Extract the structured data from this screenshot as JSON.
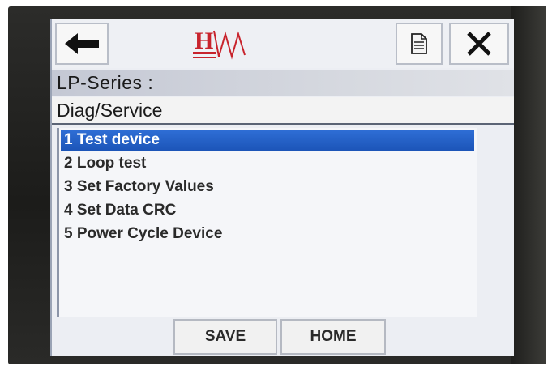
{
  "header": {
    "back_icon": "arrow-left-icon",
    "logo_text": "H",
    "doc_icon": "document-icon",
    "close_icon": "close-icon",
    "colors": {
      "logo_red": "#c8232c",
      "selection_blue": "#1f5fc4"
    }
  },
  "device": {
    "series_label": "LP-Series    :"
  },
  "menu": {
    "title": "Diag/Service"
  },
  "list": {
    "items": [
      {
        "label": "1 Test device",
        "selected": true
      },
      {
        "label": "2 Loop test",
        "selected": false
      },
      {
        "label": "3 Set Factory Values",
        "selected": false
      },
      {
        "label": "4 Set Data CRC",
        "selected": false
      },
      {
        "label": "5 Power Cycle Device",
        "selected": false
      }
    ]
  },
  "footer": {
    "save_label": "SAVE",
    "home_label": "HOME"
  }
}
